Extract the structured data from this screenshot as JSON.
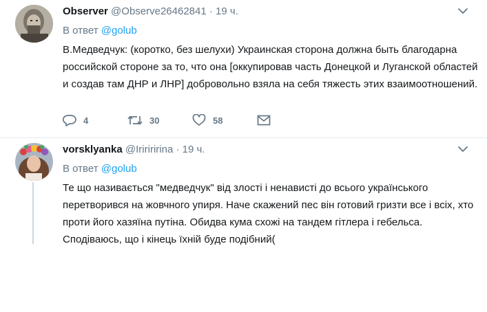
{
  "tweets": [
    {
      "author_name": "Observer",
      "handle": "@Observe26462841",
      "separator": "·",
      "time": "19 ч.",
      "reply_prefix": "В ответ",
      "reply_mention": "@golub",
      "text": "В.Медведчук: (коротко, без шелухи) Украинская сторона должна быть благодарна российской стороне за то, что она [оккупировав часть Донецкой и Луганской областей и создав там ДНР и ЛНР] добровольно взяла на себя тяжесть этих взаимоотношений.",
      "reply_count": "4",
      "retweet_count": "30",
      "like_count": "58"
    },
    {
      "author_name": "vorsklyanka",
      "handle": "@Iririririna",
      "separator": "·",
      "time": "19 ч.",
      "reply_prefix": "В ответ",
      "reply_mention": "@golub",
      "text": "Те що називається \"медведчук\" від злості і ненависті до всього українського перетворився на жовчного упиря. Наче скажений пес він готовий гризти все і всіх, хто проти його хазяїна путіна. Обидва кума схожі на тандем гітлера і гебельса. Сподіваюсь, що і кінець їхній буде подібний("
    }
  ],
  "colors": {
    "link": "#1da1f2",
    "secondary_text": "#657786",
    "primary_text": "#14171a",
    "divider": "#e6ecf0"
  }
}
